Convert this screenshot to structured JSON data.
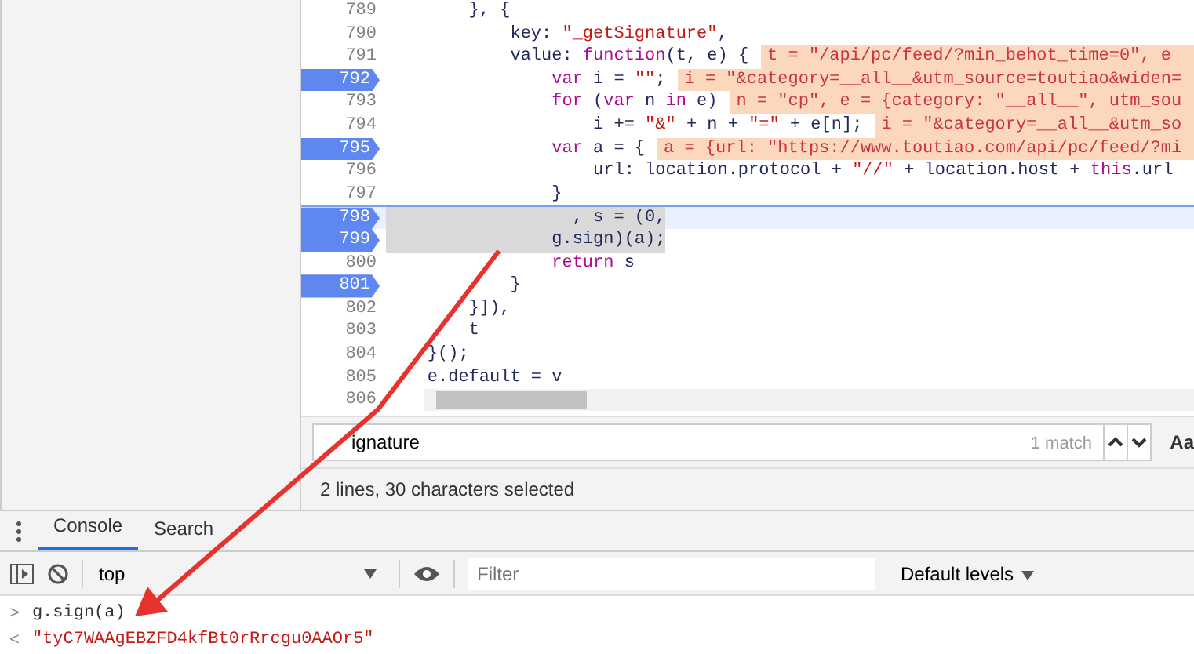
{
  "editor": {
    "lines": [
      {
        "number": "789",
        "breakpoint": false,
        "current": false,
        "selected": false,
        "code": [
          {
            "kind": "plain",
            "text": "        }, {"
          }
        ]
      },
      {
        "number": "790",
        "breakpoint": false,
        "current": false,
        "selected": false,
        "code": [
          {
            "kind": "plain",
            "text": "            key: "
          },
          {
            "kind": "string",
            "text": "\"_getSignature\""
          },
          {
            "kind": "plain",
            "text": ","
          }
        ]
      },
      {
        "number": "791",
        "breakpoint": false,
        "current": false,
        "selected": false,
        "code": [
          {
            "kind": "plain",
            "text": "            value: "
          },
          {
            "kind": "keyword",
            "text": "function"
          },
          {
            "kind": "plain",
            "text": "(t, e) {"
          }
        ],
        "inline_value": "t = \"/api/pc/feed/?min_behot_time=0\", e"
      },
      {
        "number": "792",
        "breakpoint": true,
        "current": false,
        "selected": false,
        "code": [
          {
            "kind": "keyword",
            "text": "                var"
          },
          {
            "kind": "plain",
            "text": " i = "
          },
          {
            "kind": "string",
            "text": "\"\""
          },
          {
            "kind": "plain",
            "text": ";"
          }
        ],
        "inline_value": "i = \"&category=__all__&utm_source=toutiao&widen="
      },
      {
        "number": "793",
        "breakpoint": false,
        "current": false,
        "selected": false,
        "code": [
          {
            "kind": "keyword",
            "text": "                for"
          },
          {
            "kind": "plain",
            "text": " ("
          },
          {
            "kind": "keyword",
            "text": "var"
          },
          {
            "kind": "plain",
            "text": " n "
          },
          {
            "kind": "keyword",
            "text": "in"
          },
          {
            "kind": "plain",
            "text": " e)"
          }
        ],
        "inline_value": "n = \"cp\", e = {category: \"__all__\", utm_sou"
      },
      {
        "number": "794",
        "breakpoint": false,
        "current": false,
        "selected": false,
        "code": [
          {
            "kind": "plain",
            "text": "                    i += "
          },
          {
            "kind": "string",
            "text": "\"&\""
          },
          {
            "kind": "plain",
            "text": " + n + "
          },
          {
            "kind": "string",
            "text": "\"=\""
          },
          {
            "kind": "plain",
            "text": " + e[n];"
          }
        ],
        "inline_value": "i = \"&category=__all__&utm_so"
      },
      {
        "number": "795",
        "breakpoint": true,
        "current": false,
        "selected": false,
        "code": [
          {
            "kind": "keyword",
            "text": "                var"
          },
          {
            "kind": "plain",
            "text": " a = {"
          }
        ],
        "inline_value": "a = {url: \"https://www.toutiao.com/api/pc/feed/?mi"
      },
      {
        "number": "796",
        "breakpoint": false,
        "current": false,
        "selected": false,
        "code": [
          {
            "kind": "plain",
            "text": "                    url: location.protocol + "
          },
          {
            "kind": "string",
            "text": "\"//\""
          },
          {
            "kind": "plain",
            "text": " + location.host + "
          },
          {
            "kind": "keyword",
            "text": "this"
          },
          {
            "kind": "plain",
            "text": ".url"
          }
        ]
      },
      {
        "number": "797",
        "breakpoint": false,
        "current": false,
        "selected": false,
        "code": [
          {
            "kind": "plain",
            "text": "                }"
          }
        ]
      },
      {
        "number": "798",
        "breakpoint": true,
        "current": true,
        "selected": true,
        "code": [
          {
            "kind": "plain",
            "text": "                  , s = (0,"
          }
        ]
      },
      {
        "number": "799",
        "breakpoint": true,
        "current": false,
        "selected": true,
        "code": [
          {
            "kind": "plain",
            "text": "                g.sign)(a);"
          }
        ]
      },
      {
        "number": "800",
        "breakpoint": false,
        "current": false,
        "selected": false,
        "code": [
          {
            "kind": "keyword",
            "text": "                return"
          },
          {
            "kind": "plain",
            "text": " s"
          }
        ]
      },
      {
        "number": "801",
        "breakpoint": true,
        "current": false,
        "selected": false,
        "code": [
          {
            "kind": "plain",
            "text": "            }"
          }
        ]
      },
      {
        "number": "802",
        "breakpoint": false,
        "current": false,
        "selected": false,
        "code": [
          {
            "kind": "plain",
            "text": "        }]),"
          }
        ]
      },
      {
        "number": "803",
        "breakpoint": false,
        "current": false,
        "selected": false,
        "code": [
          {
            "kind": "plain",
            "text": "        t"
          }
        ]
      },
      {
        "number": "804",
        "breakpoint": false,
        "current": false,
        "selected": false,
        "code": [
          {
            "kind": "plain",
            "text": "    }();"
          }
        ]
      },
      {
        "number": "805",
        "breakpoint": false,
        "current": false,
        "selected": false,
        "code": [
          {
            "kind": "plain",
            "text": "    e.default = v"
          }
        ]
      },
      {
        "number": "806",
        "breakpoint": false,
        "current": false
      }
    ]
  },
  "search": {
    "value": "ignature",
    "match_count": "1 match",
    "case_button": "Aa"
  },
  "status": "2 lines, 30 characters selected",
  "drawer_tabs": [
    {
      "label": "Console",
      "selected": true
    },
    {
      "label": "Search",
      "selected": false
    }
  ],
  "console_toolbar": {
    "context": "top",
    "filter_placeholder": "Filter",
    "levels": "Default levels"
  },
  "console": [
    {
      "kind": "input",
      "prompt": ">",
      "text": "g.sign(a)"
    },
    {
      "kind": "result",
      "prompt": "<",
      "text": "\"tyC7WAAgEBZFD4kfBt0rRrcgu0AAOr5\""
    }
  ]
}
